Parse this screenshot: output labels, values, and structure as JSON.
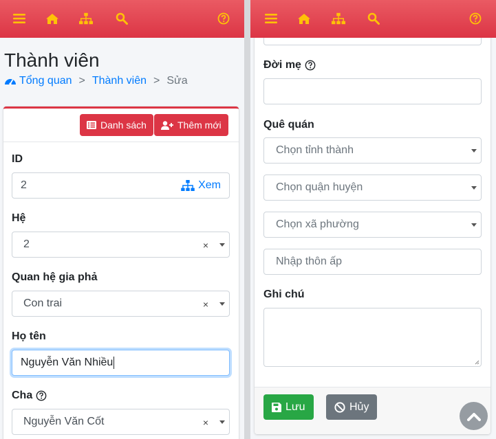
{
  "colors": {
    "topbar": "#dc3545",
    "accent_icon": "#ffc107",
    "link": "#007bff",
    "success": "#28a745",
    "secondary": "#6c757d"
  },
  "nav_icons": [
    "bars-icon",
    "home-icon",
    "sitemap-icon",
    "search-icon",
    "question-circle-icon"
  ],
  "left": {
    "page_title": "Thành viên",
    "breadcrumb": {
      "home": "Tổng quan",
      "section": "Thành viên",
      "current": "Sửa",
      "sep": ">"
    },
    "toolbar": {
      "list_label": "Danh sách",
      "add_label": "Thêm mới"
    },
    "fields": {
      "id": {
        "label": "ID",
        "value": "2",
        "view_label": "Xem"
      },
      "generation": {
        "label": "Hệ",
        "value": "2",
        "clear": "×"
      },
      "relation": {
        "label": "Quan hệ gia phả",
        "value": "Con trai",
        "clear": "×"
      },
      "full_name": {
        "label": "Họ tên",
        "value": "Nguyễn Văn Nhiều"
      },
      "father": {
        "label": "Cha",
        "value": "Nguyễn Văn Cốt",
        "clear": "×"
      }
    }
  },
  "right": {
    "mother_spouse": {
      "label": "Đời mẹ",
      "value": ""
    },
    "hometown": {
      "label": "Quê quán",
      "province_placeholder": "Chọn tỉnh thành",
      "district_placeholder": "Chọn quận huyện",
      "ward_placeholder": "Chọn xã phường",
      "hamlet_placeholder": "Nhập thôn ấp"
    },
    "note": {
      "label": "Ghi chú",
      "value": ""
    },
    "actions": {
      "save_label": "Lưu",
      "cancel_label": "Hủy"
    }
  }
}
